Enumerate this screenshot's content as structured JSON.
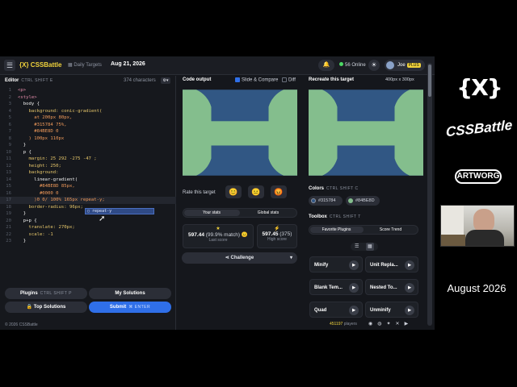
{
  "topbar": {
    "menu_icon": "menu-icon",
    "title": "{X} CSSBattle",
    "daily_targets": "Daily Targets",
    "date": "Aug 21, 2026",
    "bell_count": "0",
    "online": "56 Online",
    "user": "Joe",
    "plus_badge": "PLUS"
  },
  "editor": {
    "header": "Editor",
    "shortcut": "CTRL SHIFT E",
    "chars": "374 characters",
    "lines": [
      {
        "n": "1",
        "t": "<p>"
      },
      {
        "n": "2",
        "t": "<style>"
      },
      {
        "n": "3",
        "t": "  body {"
      },
      {
        "n": "4",
        "t": "    background: conic-gradient("
      },
      {
        "n": "5",
        "t": "      at 200px 80px,"
      },
      {
        "n": "6",
        "t": "      #315784 75%,"
      },
      {
        "n": "7",
        "t": "      #84BE8D 0"
      },
      {
        "n": "8",
        "t": "    ) 100px 110px"
      },
      {
        "n": "9",
        "t": "  }"
      },
      {
        "n": "10",
        "t": "  p {"
      },
      {
        "n": "11",
        "t": "    margin: 25 292 -275 -47 ;"
      },
      {
        "n": "12",
        "t": "    height: 250;"
      },
      {
        "n": "13",
        "t": "    background:"
      },
      {
        "n": "14",
        "t": "      linear-gradient("
      },
      {
        "n": "15",
        "t": "        #84BE8D 85px,"
      },
      {
        "n": "16",
        "t": "        #0000 0"
      },
      {
        "n": "17",
        "t": "      )0 0/ 100% 165px repeat-y;"
      },
      {
        "n": "18",
        "t": "    border-radius: 96px;"
      },
      {
        "n": "19",
        "t": "  }"
      },
      {
        "n": "20",
        "t": "  p+p {"
      },
      {
        "n": "21",
        "t": "    translate: 270px;"
      },
      {
        "n": "22",
        "t": "    scale: -1"
      },
      {
        "n": "23",
        "t": "  }"
      }
    ],
    "autocomplete": "repeat-y"
  },
  "bottom_buttons": {
    "plugins": "Plugins",
    "plugins_kbd": "CTRL SHIFT P",
    "my_solutions": "My Solutions",
    "top_solutions": "Top Solutions",
    "submit": "Submit",
    "submit_kbd": "⌘ ENTER"
  },
  "footer": {
    "copyright": "© 2026 CSSBattle",
    "players": "451197",
    "players_label": "players"
  },
  "output": {
    "header": "Code output",
    "slide_compare": "Slide & Compare",
    "diff": "Diff",
    "rate": "Rate this target",
    "tab_your": "Your stats",
    "tab_global": "Global stats",
    "last_score": "597.44",
    "last_match": "(99.9% match)",
    "last_label": "Last score",
    "high_score": "597.45",
    "high_chars": "(375)",
    "high_label": "High score",
    "challenge": "Challenge"
  },
  "target": {
    "header": "Recreate this target",
    "size": "400px x 300px",
    "colors_label": "Colors",
    "colors_kbd": "CTRL SHIFT C",
    "colors": [
      {
        "hex": "#315784"
      },
      {
        "hex": "#84BE8D"
      }
    ],
    "toolbox": "Toolbox",
    "toolbox_kbd": "CTRL SHIFT T",
    "tab_fav": "Favorite Plugins",
    "tab_trend": "Score Trend",
    "tools": [
      "Minify",
      "Unit Repla...",
      "Blank Tem...",
      "Nested To...",
      "Quad",
      "Unminify"
    ]
  },
  "brand": {
    "logo": "{X}",
    "logo2": "CSSBattle",
    "logo3": "ARTWORG",
    "month": "August 2026"
  },
  "colors": {
    "blue": "#315784",
    "green": "#84BE8D",
    "accent": "#2f6fe8",
    "yellow": "#f1d33c"
  }
}
